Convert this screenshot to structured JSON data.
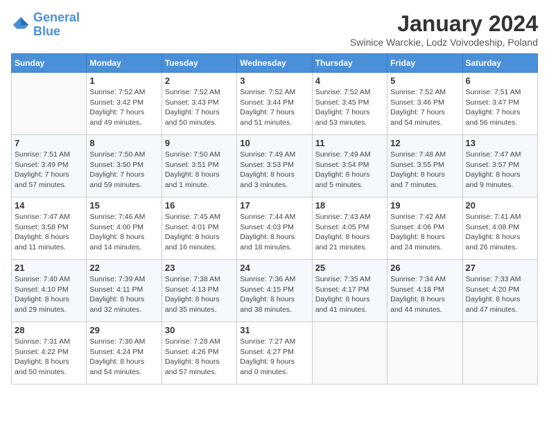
{
  "header": {
    "logo_line1": "General",
    "logo_line2": "Blue",
    "month": "January 2024",
    "location": "Swinice Warckie, Lodz Voivodeship, Poland"
  },
  "days_of_week": [
    "Sunday",
    "Monday",
    "Tuesday",
    "Wednesday",
    "Thursday",
    "Friday",
    "Saturday"
  ],
  "weeks": [
    [
      {
        "day": "",
        "info": ""
      },
      {
        "day": "1",
        "info": "Sunrise: 7:52 AM\nSunset: 3:42 PM\nDaylight: 7 hours\nand 49 minutes."
      },
      {
        "day": "2",
        "info": "Sunrise: 7:52 AM\nSunset: 3:43 PM\nDaylight: 7 hours\nand 50 minutes."
      },
      {
        "day": "3",
        "info": "Sunrise: 7:52 AM\nSunset: 3:44 PM\nDaylight: 7 hours\nand 51 minutes."
      },
      {
        "day": "4",
        "info": "Sunrise: 7:52 AM\nSunset: 3:45 PM\nDaylight: 7 hours\nand 53 minutes."
      },
      {
        "day": "5",
        "info": "Sunrise: 7:52 AM\nSunset: 3:46 PM\nDaylight: 7 hours\nand 54 minutes."
      },
      {
        "day": "6",
        "info": "Sunrise: 7:51 AM\nSunset: 3:47 PM\nDaylight: 7 hours\nand 56 minutes."
      }
    ],
    [
      {
        "day": "7",
        "info": "Sunrise: 7:51 AM\nSunset: 3:49 PM\nDaylight: 7 hours\nand 57 minutes."
      },
      {
        "day": "8",
        "info": "Sunrise: 7:50 AM\nSunset: 3:50 PM\nDaylight: 7 hours\nand 59 minutes."
      },
      {
        "day": "9",
        "info": "Sunrise: 7:50 AM\nSunset: 3:51 PM\nDaylight: 8 hours\nand 1 minute."
      },
      {
        "day": "10",
        "info": "Sunrise: 7:49 AM\nSunset: 3:53 PM\nDaylight: 8 hours\nand 3 minutes."
      },
      {
        "day": "11",
        "info": "Sunrise: 7:49 AM\nSunset: 3:54 PM\nDaylight: 8 hours\nand 5 minutes."
      },
      {
        "day": "12",
        "info": "Sunrise: 7:48 AM\nSunset: 3:55 PM\nDaylight: 8 hours\nand 7 minutes."
      },
      {
        "day": "13",
        "info": "Sunrise: 7:47 AM\nSunset: 3:57 PM\nDaylight: 8 hours\nand 9 minutes."
      }
    ],
    [
      {
        "day": "14",
        "info": "Sunrise: 7:47 AM\nSunset: 3:58 PM\nDaylight: 8 hours\nand 11 minutes."
      },
      {
        "day": "15",
        "info": "Sunrise: 7:46 AM\nSunset: 4:00 PM\nDaylight: 8 hours\nand 14 minutes."
      },
      {
        "day": "16",
        "info": "Sunrise: 7:45 AM\nSunset: 4:01 PM\nDaylight: 8 hours\nand 16 minutes."
      },
      {
        "day": "17",
        "info": "Sunrise: 7:44 AM\nSunset: 4:03 PM\nDaylight: 8 hours\nand 18 minutes."
      },
      {
        "day": "18",
        "info": "Sunrise: 7:43 AM\nSunset: 4:05 PM\nDaylight: 8 hours\nand 21 minutes."
      },
      {
        "day": "19",
        "info": "Sunrise: 7:42 AM\nSunset: 4:06 PM\nDaylight: 8 hours\nand 24 minutes."
      },
      {
        "day": "20",
        "info": "Sunrise: 7:41 AM\nSunset: 4:08 PM\nDaylight: 8 hours\nand 26 minutes."
      }
    ],
    [
      {
        "day": "21",
        "info": "Sunrise: 7:40 AM\nSunset: 4:10 PM\nDaylight: 8 hours\nand 29 minutes."
      },
      {
        "day": "22",
        "info": "Sunrise: 7:39 AM\nSunset: 4:11 PM\nDaylight: 8 hours\nand 32 minutes."
      },
      {
        "day": "23",
        "info": "Sunrise: 7:38 AM\nSunset: 4:13 PM\nDaylight: 8 hours\nand 35 minutes."
      },
      {
        "day": "24",
        "info": "Sunrise: 7:36 AM\nSunset: 4:15 PM\nDaylight: 8 hours\nand 38 minutes."
      },
      {
        "day": "25",
        "info": "Sunrise: 7:35 AM\nSunset: 4:17 PM\nDaylight: 8 hours\nand 41 minutes."
      },
      {
        "day": "26",
        "info": "Sunrise: 7:34 AM\nSunset: 4:18 PM\nDaylight: 8 hours\nand 44 minutes."
      },
      {
        "day": "27",
        "info": "Sunrise: 7:33 AM\nSunset: 4:20 PM\nDaylight: 8 hours\nand 47 minutes."
      }
    ],
    [
      {
        "day": "28",
        "info": "Sunrise: 7:31 AM\nSunset: 4:22 PM\nDaylight: 8 hours\nand 50 minutes."
      },
      {
        "day": "29",
        "info": "Sunrise: 7:30 AM\nSunset: 4:24 PM\nDaylight: 8 hours\nand 54 minutes."
      },
      {
        "day": "30",
        "info": "Sunrise: 7:28 AM\nSunset: 4:26 PM\nDaylight: 8 hours\nand 57 minutes."
      },
      {
        "day": "31",
        "info": "Sunrise: 7:27 AM\nSunset: 4:27 PM\nDaylight: 9 hours\nand 0 minutes."
      },
      {
        "day": "",
        "info": ""
      },
      {
        "day": "",
        "info": ""
      },
      {
        "day": "",
        "info": ""
      }
    ]
  ]
}
